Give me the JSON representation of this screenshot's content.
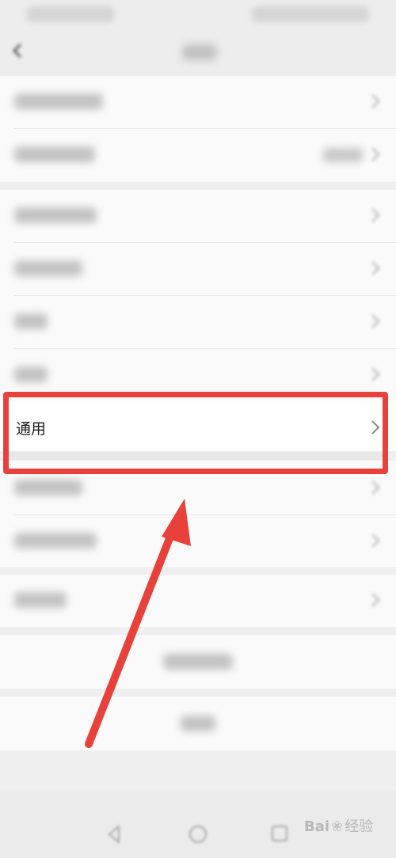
{
  "settings": {
    "general_label": "通用"
  },
  "watermark": {
    "brand_prefix": "Bai",
    "brand_suffix": "经验"
  },
  "colors": {
    "highlight": "#e8413b",
    "arrow": "#e8413b"
  }
}
